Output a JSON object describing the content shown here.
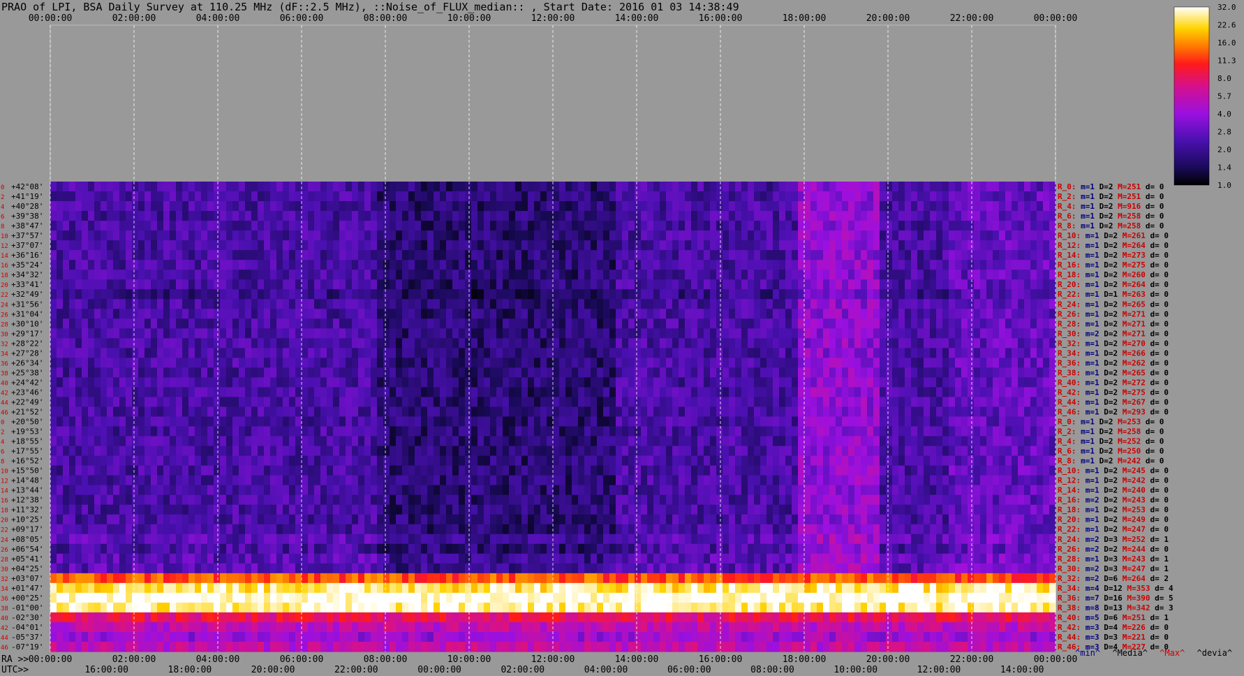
{
  "title": "PRAO of LPI, BSA Daily Survey at 110.25 MHz (dF::2.5 MHz), ::Noise_of_FLUX_median:: , Start Date: 2016 01 03 14:38:49",
  "chart_data": {
    "type": "heatmap",
    "title": "PRAO of LPI, BSA Daily Survey at 110.25 MHz (dF::2.5 MHz), ::Noise_of_FLUX_median:: , Start Date: 2016 01 03 14:38:49",
    "top_axis_ticks": [
      "00:00:00",
      "02:00:00",
      "04:00:00",
      "06:00:00",
      "08:00:00",
      "10:00:00",
      "12:00:00",
      "14:00:00",
      "16:00:00",
      "18:00:00",
      "20:00:00",
      "22:00:00",
      "00:00:00"
    ],
    "ra_prefix": "RA >>",
    "ra_ticks": [
      "00:00:00",
      "02:00:00",
      "04:00:00",
      "06:00:00",
      "08:00:00",
      "10:00:00",
      "12:00:00",
      "14:00:00",
      "16:00:00",
      "18:00:00",
      "20:00:00",
      "22:00:00",
      "00:00:00"
    ],
    "utc_prefix": "UTC>>",
    "utc_ticks": [
      "16:00:00",
      "18:00:00",
      "20:00:00",
      "22:00:00",
      "00:00:00",
      "02:00:00",
      "04:00:00",
      "06:00:00",
      "08:00:00",
      "10:00:00",
      "12:00:00",
      "14:00:00"
    ],
    "colorbar_ticks": [
      "32.0",
      "22.6",
      "16.0",
      "11.3",
      "8.0",
      "5.7",
      "4.0",
      "2.8",
      "2.0",
      "1.4",
      "1.0"
    ],
    "colorbar_scale": "log",
    "colorbar_range": [
      1.0,
      32.0
    ],
    "declinations": [
      "+42°08'",
      "+41°19'",
      "+40°28'",
      "+39°38'",
      "+38°47'",
      "+37°57'",
      "+37°07'",
      "+36°16'",
      "+35°24'",
      "+34°32'",
      "+33°41'",
      "+32°49'",
      "+31°56'",
      "+31°04'",
      "+30°10'",
      "+29°17'",
      "+28°22'",
      "+27°28'",
      "+26°34'",
      "+25°38'",
      "+24°42'",
      "+23°46'",
      "+22°49'",
      "+21°52'",
      "+20°50'",
      "+19°53'",
      "+18°55'",
      "+17°55'",
      "+16°52'",
      "+15°50'",
      "+14°48'",
      "+13°44'",
      "+12°38'",
      "+11°32'",
      "+10°25'",
      "+09°17'",
      "+08°05'",
      "+06°54'",
      "+05°41'",
      "+04°25'",
      "+03°07'",
      "+01°47'",
      "+00°25'",
      "-01°00'",
      "-02°30'",
      "-04°01'",
      "-05°37'",
      "-07°19'"
    ],
    "beam_numbers": [
      "0",
      "2",
      "4",
      "6",
      "8",
      "10",
      "12",
      "14",
      "16",
      "18",
      "20",
      "22",
      "24",
      "26",
      "28",
      "30",
      "32",
      "34",
      "36",
      "38",
      "40",
      "42",
      "44",
      "46",
      "0",
      "2",
      "4",
      "6",
      "8",
      "10",
      "12",
      "14",
      "16",
      "18",
      "20",
      "22",
      "24",
      "26",
      "28",
      "30",
      "32",
      "34",
      "36",
      "38",
      "40",
      "42",
      "44",
      "46"
    ],
    "row_stats": [
      {
        "r": "R_0:",
        "m": "1",
        "D": "2",
        "M": "251",
        "d": "0"
      },
      {
        "r": "R_2:",
        "m": "1",
        "D": "2",
        "M": "251",
        "d": "0"
      },
      {
        "r": "R_4:",
        "m": "1",
        "D": "2",
        "M": "916",
        "d": "0"
      },
      {
        "r": "R_6:",
        "m": "1",
        "D": "2",
        "M": "258",
        "d": "0"
      },
      {
        "r": "R_8:",
        "m": "1",
        "D": "2",
        "M": "258",
        "d": "0"
      },
      {
        "r": "R_10:",
        "m": "1",
        "D": "2",
        "M": "261",
        "d": "0"
      },
      {
        "r": "R_12:",
        "m": "1",
        "D": "2",
        "M": "264",
        "d": "0"
      },
      {
        "r": "R_14:",
        "m": "1",
        "D": "2",
        "M": "273",
        "d": "0"
      },
      {
        "r": "R_16:",
        "m": "1",
        "D": "2",
        "M": "275",
        "d": "0"
      },
      {
        "r": "R_18:",
        "m": "1",
        "D": "2",
        "M": "260",
        "d": "0"
      },
      {
        "r": "R_20:",
        "m": "1",
        "D": "2",
        "M": "264",
        "d": "0"
      },
      {
        "r": "R_22:",
        "m": "1",
        "D": "1",
        "M": "263",
        "d": "0"
      },
      {
        "r": "R_24:",
        "m": "1",
        "D": "2",
        "M": "265",
        "d": "0"
      },
      {
        "r": "R_26:",
        "m": "1",
        "D": "2",
        "M": "271",
        "d": "0"
      },
      {
        "r": "R_28:",
        "m": "1",
        "D": "2",
        "M": "271",
        "d": "0"
      },
      {
        "r": "R_30:",
        "m": "2",
        "D": "2",
        "M": "271",
        "d": "0"
      },
      {
        "r": "R_32:",
        "m": "1",
        "D": "2",
        "M": "270",
        "d": "0"
      },
      {
        "r": "R_34:",
        "m": "1",
        "D": "2",
        "M": "266",
        "d": "0"
      },
      {
        "r": "R_36:",
        "m": "1",
        "D": "2",
        "M": "262",
        "d": "0"
      },
      {
        "r": "R_38:",
        "m": "1",
        "D": "2",
        "M": "265",
        "d": "0"
      },
      {
        "r": "R_40:",
        "m": "1",
        "D": "2",
        "M": "272",
        "d": "0"
      },
      {
        "r": "R_42:",
        "m": "1",
        "D": "2",
        "M": "275",
        "d": "0"
      },
      {
        "r": "R_44:",
        "m": "1",
        "D": "2",
        "M": "267",
        "d": "0"
      },
      {
        "r": "R_46:",
        "m": "1",
        "D": "2",
        "M": "293",
        "d": "0"
      },
      {
        "r": "R_0:",
        "m": "1",
        "D": "2",
        "M": "253",
        "d": "0"
      },
      {
        "r": "R_2:",
        "m": "1",
        "D": "2",
        "M": "258",
        "d": "0"
      },
      {
        "r": "R_4:",
        "m": "1",
        "D": "2",
        "M": "252",
        "d": "0"
      },
      {
        "r": "R_6:",
        "m": "1",
        "D": "2",
        "M": "250",
        "d": "0"
      },
      {
        "r": "R_8:",
        "m": "1",
        "D": "2",
        "M": "242",
        "d": "0"
      },
      {
        "r": "R_10:",
        "m": "1",
        "D": "2",
        "M": "245",
        "d": "0"
      },
      {
        "r": "R_12:",
        "m": "1",
        "D": "2",
        "M": "242",
        "d": "0"
      },
      {
        "r": "R_14:",
        "m": "1",
        "D": "2",
        "M": "240",
        "d": "0"
      },
      {
        "r": "R_16:",
        "m": "2",
        "D": "2",
        "M": "243",
        "d": "0"
      },
      {
        "r": "R_18:",
        "m": "1",
        "D": "2",
        "M": "253",
        "d": "0"
      },
      {
        "r": "R_20:",
        "m": "1",
        "D": "2",
        "M": "249",
        "d": "0"
      },
      {
        "r": "R_22:",
        "m": "1",
        "D": "2",
        "M": "247",
        "d": "0"
      },
      {
        "r": "R_24:",
        "m": "2",
        "D": "3",
        "M": "252",
        "d": "1"
      },
      {
        "r": "R_26:",
        "m": "2",
        "D": "2",
        "M": "244",
        "d": "0"
      },
      {
        "r": "R_28:",
        "m": "1",
        "D": "3",
        "M": "243",
        "d": "1"
      },
      {
        "r": "R_30:",
        "m": "2",
        "D": "3",
        "M": "247",
        "d": "1"
      },
      {
        "r": "R_32:",
        "m": "2",
        "D": "6",
        "M": "264",
        "d": "2"
      },
      {
        "r": "R_34:",
        "m": "4",
        "D": "12",
        "M": "353",
        "d": "4"
      },
      {
        "r": "R_36:",
        "m": "7",
        "D": "16",
        "M": "390",
        "d": "5"
      },
      {
        "r": "R_38:",
        "m": "8",
        "D": "13",
        "M": "342",
        "d": "3"
      },
      {
        "r": "R_40:",
        "m": "5",
        "D": "6",
        "M": "251",
        "d": "1"
      },
      {
        "r": "R_42:",
        "m": "3",
        "D": "4",
        "M": "226",
        "d": "0"
      },
      {
        "r": "R_44:",
        "m": "3",
        "D": "3",
        "M": "221",
        "d": "0"
      },
      {
        "r": "R_46:",
        "m": "3",
        "D": "4",
        "M": "227",
        "d": "0"
      }
    ],
    "stats_legend": [
      "^min^",
      "^Media^",
      "^Max^",
      "^devia^"
    ],
    "colors": {
      "background": "#999999",
      "text": "#000000",
      "beam_number": "#cc0000",
      "stat_label": "#cc0000",
      "stat_min": "#000080",
      "stat_max": "#cc0000",
      "grid": "#ffffff"
    }
  }
}
